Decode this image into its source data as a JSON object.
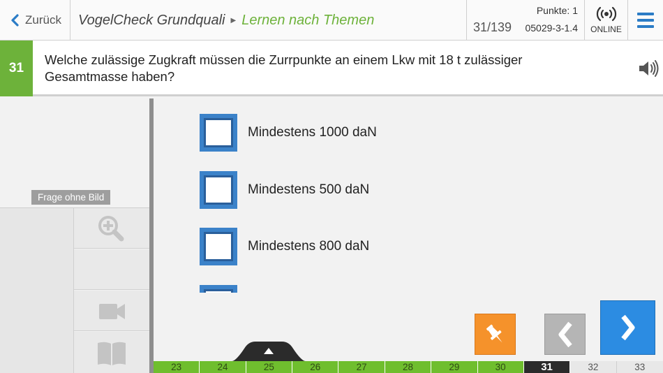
{
  "header": {
    "back_label": "Zurück",
    "app_title": "VogelCheck Grundquali",
    "section_title": "Lernen nach Themen",
    "points": "Punkte: 1",
    "progress": "31/139",
    "question_code": "05029-3-1.4",
    "online_label": "ONLINE"
  },
  "question": {
    "number": "31",
    "text": "Welche zulässige Zugkraft müssen die Zurrpunkte an einem Lkw mit 18 t zulässiger Gesamtmasse haben?"
  },
  "media_panel": {
    "no_image_label": "Frage ohne Bild",
    "tools": [
      "zoom-icon",
      "video-icon",
      "book-icon"
    ]
  },
  "answers": [
    {
      "text": "Mindestens 1000 daN",
      "checked": false
    },
    {
      "text": "Mindestens 500 daN",
      "checked": false
    },
    {
      "text": "Mindestens 800 daN",
      "checked": false
    },
    {
      "text": "",
      "checked": false
    }
  ],
  "pager": {
    "pages": [
      "23",
      "24",
      "25",
      "26",
      "27",
      "28",
      "29",
      "30",
      "31",
      "32",
      "33"
    ],
    "current": "31"
  },
  "colors": {
    "accent_green": "#6db23a",
    "accent_blue": "#2c8ce2",
    "checkbox_blue": "#3b82c9",
    "pin_orange": "#f5922b"
  }
}
